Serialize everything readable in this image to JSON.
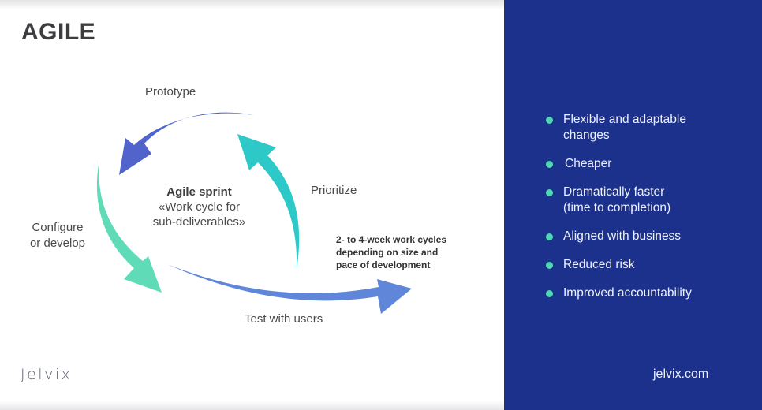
{
  "title": "AGILE",
  "diagram": {
    "stages": {
      "prototype": "Prototype",
      "prioritize": "Prioritize",
      "configure": "Configure\nor develop",
      "configure_line1": "Configure",
      "configure_line2": "or develop",
      "test": "Test with users"
    },
    "center": {
      "title": "Agile sprint",
      "line1": "«Work cycle for",
      "line2": "sub-deliverables»"
    },
    "cycle_note": {
      "line1": "2- to 4-week work cycles",
      "line2": "depending on size and",
      "line3": "pace of development"
    },
    "arrow_colors": {
      "prototype": "#5064cc",
      "prioritize": "#2cc9c8",
      "configure": "#5fdbb8",
      "test": "#5f86d8"
    }
  },
  "logo": "Jelvix",
  "benefits": {
    "items": [
      {
        "line1": "Flexible and adaptable",
        "line2": "changes"
      },
      {
        "line1": "Cheaper",
        "line2": ""
      },
      {
        "line1": "Dramatically faster",
        "line2": "(time to completion)"
      },
      {
        "line1": "Aligned with business",
        "line2": ""
      },
      {
        "line1": "Reduced risk",
        "line2": ""
      },
      {
        "line1": "Improved accountability",
        "line2": ""
      }
    ],
    "bullet_color": "#4fd6b5",
    "panel_color": "#1b318c"
  },
  "site": "jelvix.com"
}
